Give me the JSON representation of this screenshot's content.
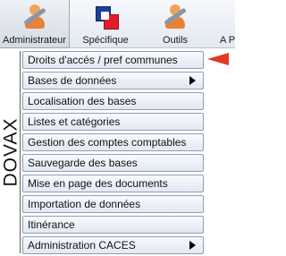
{
  "toolbar": {
    "buttons": [
      {
        "label": "Administrateur",
        "icon": "admin-icon",
        "selected": true
      },
      {
        "label": "Spécifique",
        "icon": "specific-icon"
      },
      {
        "label": "Outils",
        "icon": "tools-icon"
      },
      {
        "label": "A P",
        "icon": ""
      }
    ]
  },
  "side_label": "DOVAX",
  "menu": {
    "items": [
      {
        "label": "Droits d'accés / pref communes",
        "submenu": false
      },
      {
        "label": "Bases de données",
        "submenu": true
      },
      {
        "label": "Localisation des bases",
        "submenu": false
      },
      {
        "label": "Listes et catégories",
        "submenu": false
      },
      {
        "label": "Gestion des comptes comptables",
        "submenu": false
      },
      {
        "label": "Sauvegarde des bases",
        "submenu": false
      },
      {
        "label": "Mise en page des documents",
        "submenu": false
      },
      {
        "label": "Importation de données",
        "submenu": false
      },
      {
        "label": "Itinérance",
        "submenu": false
      },
      {
        "label": "Administration CACES",
        "submenu": true
      }
    ],
    "pointer_icon": "red-arrow-pointer-icon"
  },
  "colors": {
    "pointer": "#e03a20",
    "spec_blue": "#1c3e9c",
    "spec_red": "#e01e2a"
  }
}
